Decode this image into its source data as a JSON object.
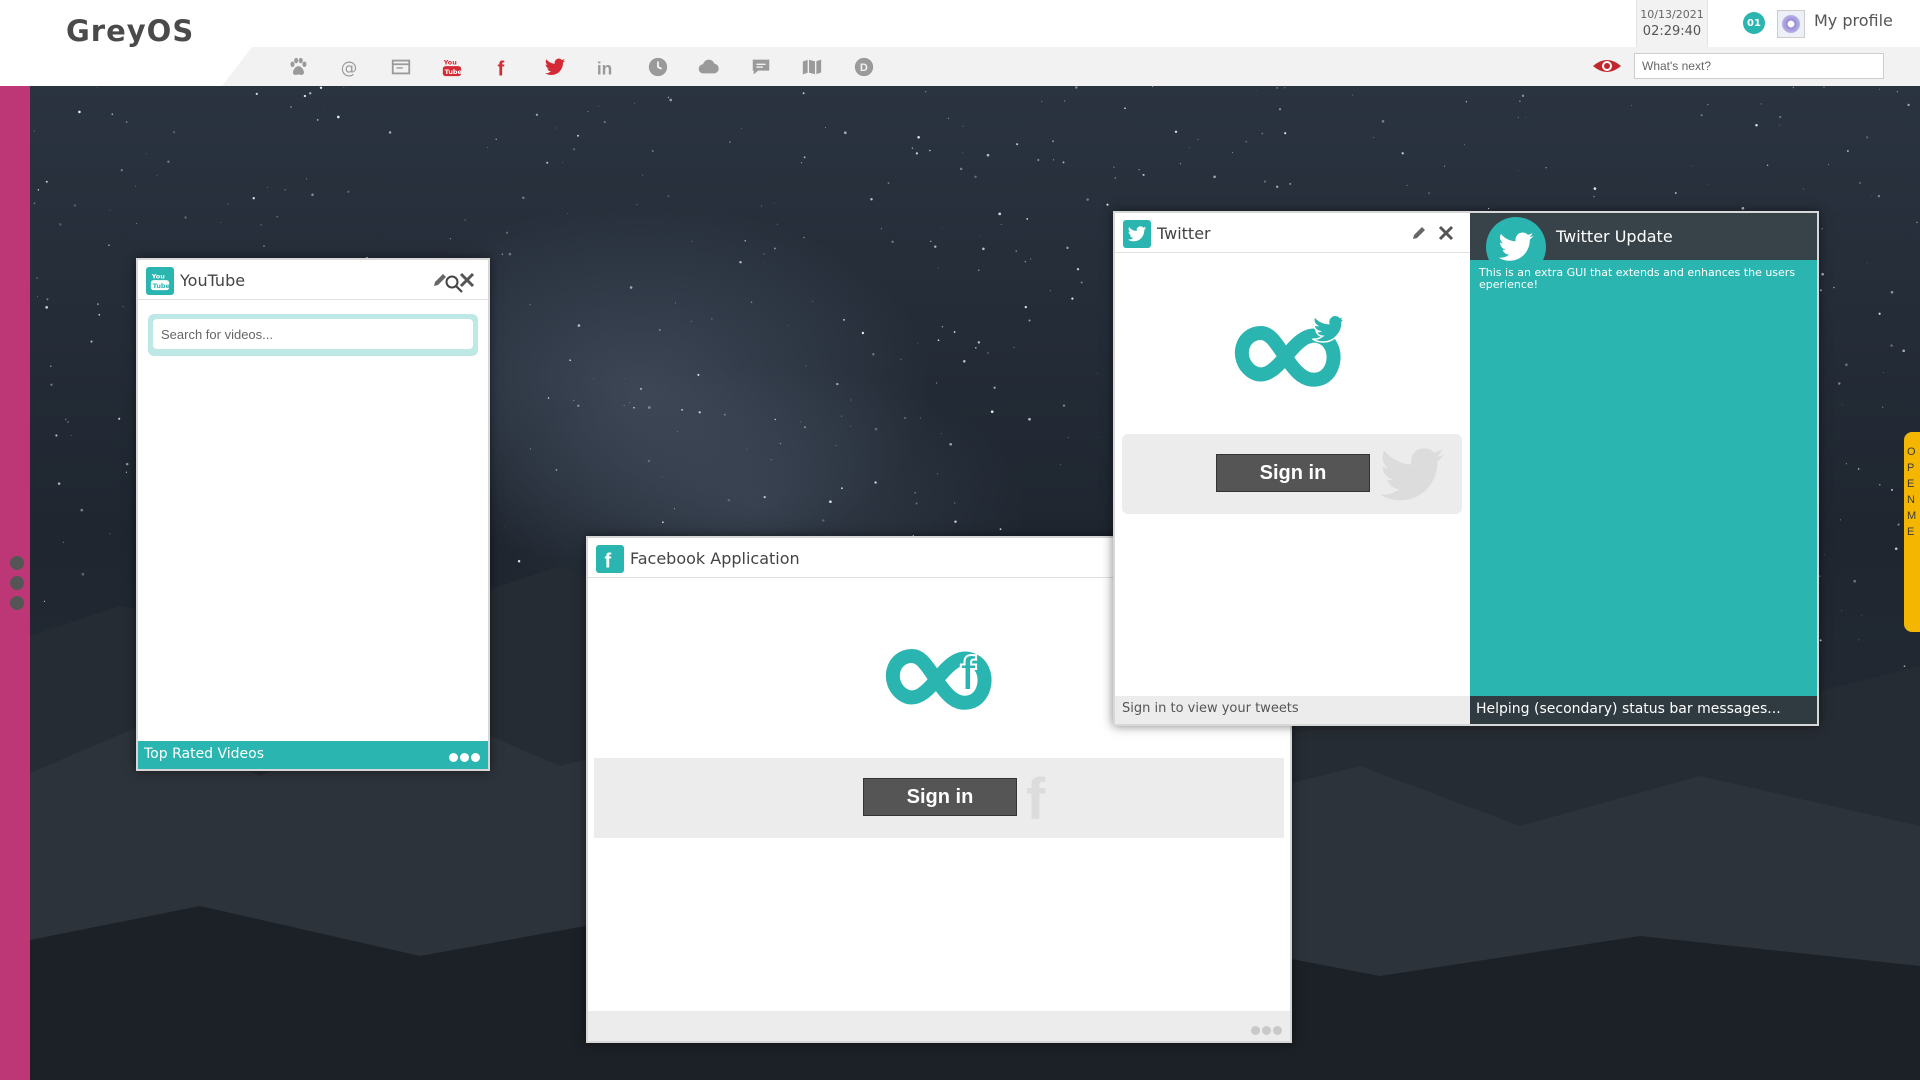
{
  "topbar": {
    "logo": "GreyOS",
    "icons": [
      "paw-icon",
      "at-icon",
      "browser-icon",
      "youtube-icon",
      "facebook-icon",
      "twitter-icon",
      "linkedin-icon",
      "clock-icon",
      "cloud-icon",
      "chat-icon",
      "map-icon",
      "disqus-icon"
    ],
    "date": "10/13/2021",
    "time": "02:29:40",
    "notifications": "01",
    "profile_label": "My profile",
    "search_placeholder": "What's next?"
  },
  "colors": {
    "accent": "#2bb5b0",
    "sidebar": "#bd3777",
    "dark_button": "#555555",
    "open_tab": "#f5b600",
    "red_icons": "#d42a36"
  },
  "side_tab": "OPEN ME",
  "youtube_window": {
    "title": "YouTube",
    "search_placeholder": "Search for videos...",
    "footer": "Top Rated Videos"
  },
  "facebook_window": {
    "title": "Facebook Application",
    "sign_in": "Sign in",
    "watermark": "f"
  },
  "twitter_window": {
    "title": "Twitter",
    "sign_in": "Sign in",
    "status": "Sign in to view your tweets",
    "extension": {
      "title": "Twitter Update",
      "description": "This is an extra GUI that extends and enhances the users eperience!",
      "status": "Helping (secondary) status bar messages..."
    }
  }
}
